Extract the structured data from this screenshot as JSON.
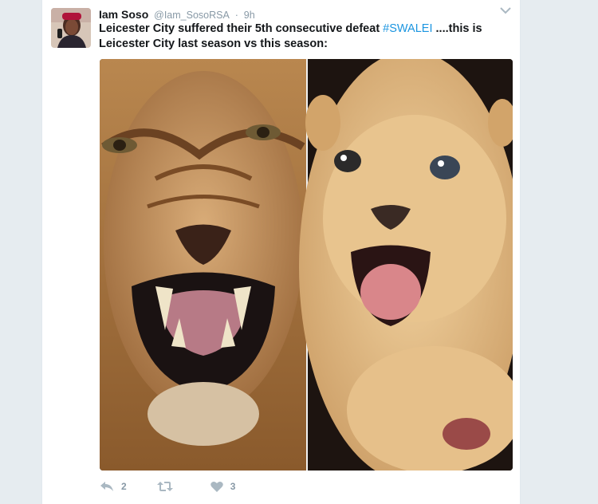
{
  "tweet": {
    "author_name": "Iam Soso",
    "handle": "@Iam_SosoRSA",
    "separator": "·",
    "time": "9h",
    "text_part1": "Leicester City suffered their 5th consecutive defeat ",
    "hashtag": "#SWALEI",
    "text_part2": " ....this is Leicester City last season vs this season:",
    "colors": {
      "hashtag": "#1b95e0",
      "icon": "#aab8c2"
    }
  },
  "media": {
    "left_panel": "adult-lion-roaring",
    "right_panel": "lion-cub-mouth-open"
  },
  "actions": {
    "reply_icon": "reply-icon",
    "reply_count": "2",
    "retweet_icon": "retweet-icon",
    "retweet_count": "",
    "like_icon": "heart-icon",
    "like_count": "3"
  }
}
